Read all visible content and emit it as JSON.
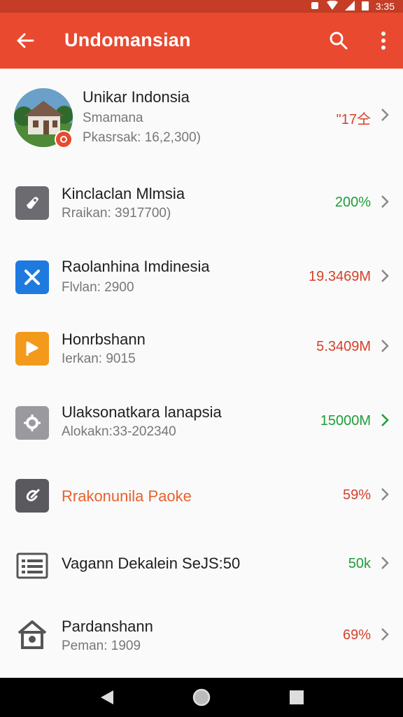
{
  "status_bar": {
    "time": "3:35"
  },
  "app_bar": {
    "title": "Undomansian"
  },
  "colors": {
    "accent": "#e8492f",
    "value_red": "#d6402a",
    "value_green": "#1f9d3a",
    "title_orange": "#e8612e"
  },
  "items": [
    {
      "title": "Unikar Indonsia",
      "subtitle": "Smamana",
      "subtitle2": "Pkasrsak: 16,2,300)",
      "value": "\"17仝",
      "value_color": "red",
      "icon": "house-photo-avatar"
    },
    {
      "title": "Kinclaclan Mlmsia",
      "subtitle": "Rraikan: 3917700)",
      "value": "200%",
      "value_color": "green",
      "icon": "tag-icon"
    },
    {
      "title": "Raolanhina Imdinesia",
      "subtitle": "Flvlan: 2900",
      "value": "19.3469M",
      "value_color": "red",
      "icon": "tools-icon"
    },
    {
      "title": "Honrbshann",
      "subtitle": "Ierkan: 9015",
      "value": "5.3409M",
      "value_color": "red",
      "icon": "flag-icon"
    },
    {
      "title": "Ulaksonatkara lanapsia",
      "subtitle": "Alokakn:33-202340",
      "value": "15000M",
      "value_color": "green",
      "icon": "folder-gear-icon"
    },
    {
      "title": "Rrakonunila Paoke",
      "value": "59%",
      "value_color": "red",
      "icon": "edit-icon"
    },
    {
      "title": "Vagann Dekalein SeJS:50",
      "value": "50k",
      "value_color": "green",
      "icon": "document-list-icon"
    },
    {
      "title": "Pardanshann",
      "subtitle": "Peman: 1909",
      "value": "69%",
      "value_color": "red",
      "icon": "home-icon"
    }
  ]
}
